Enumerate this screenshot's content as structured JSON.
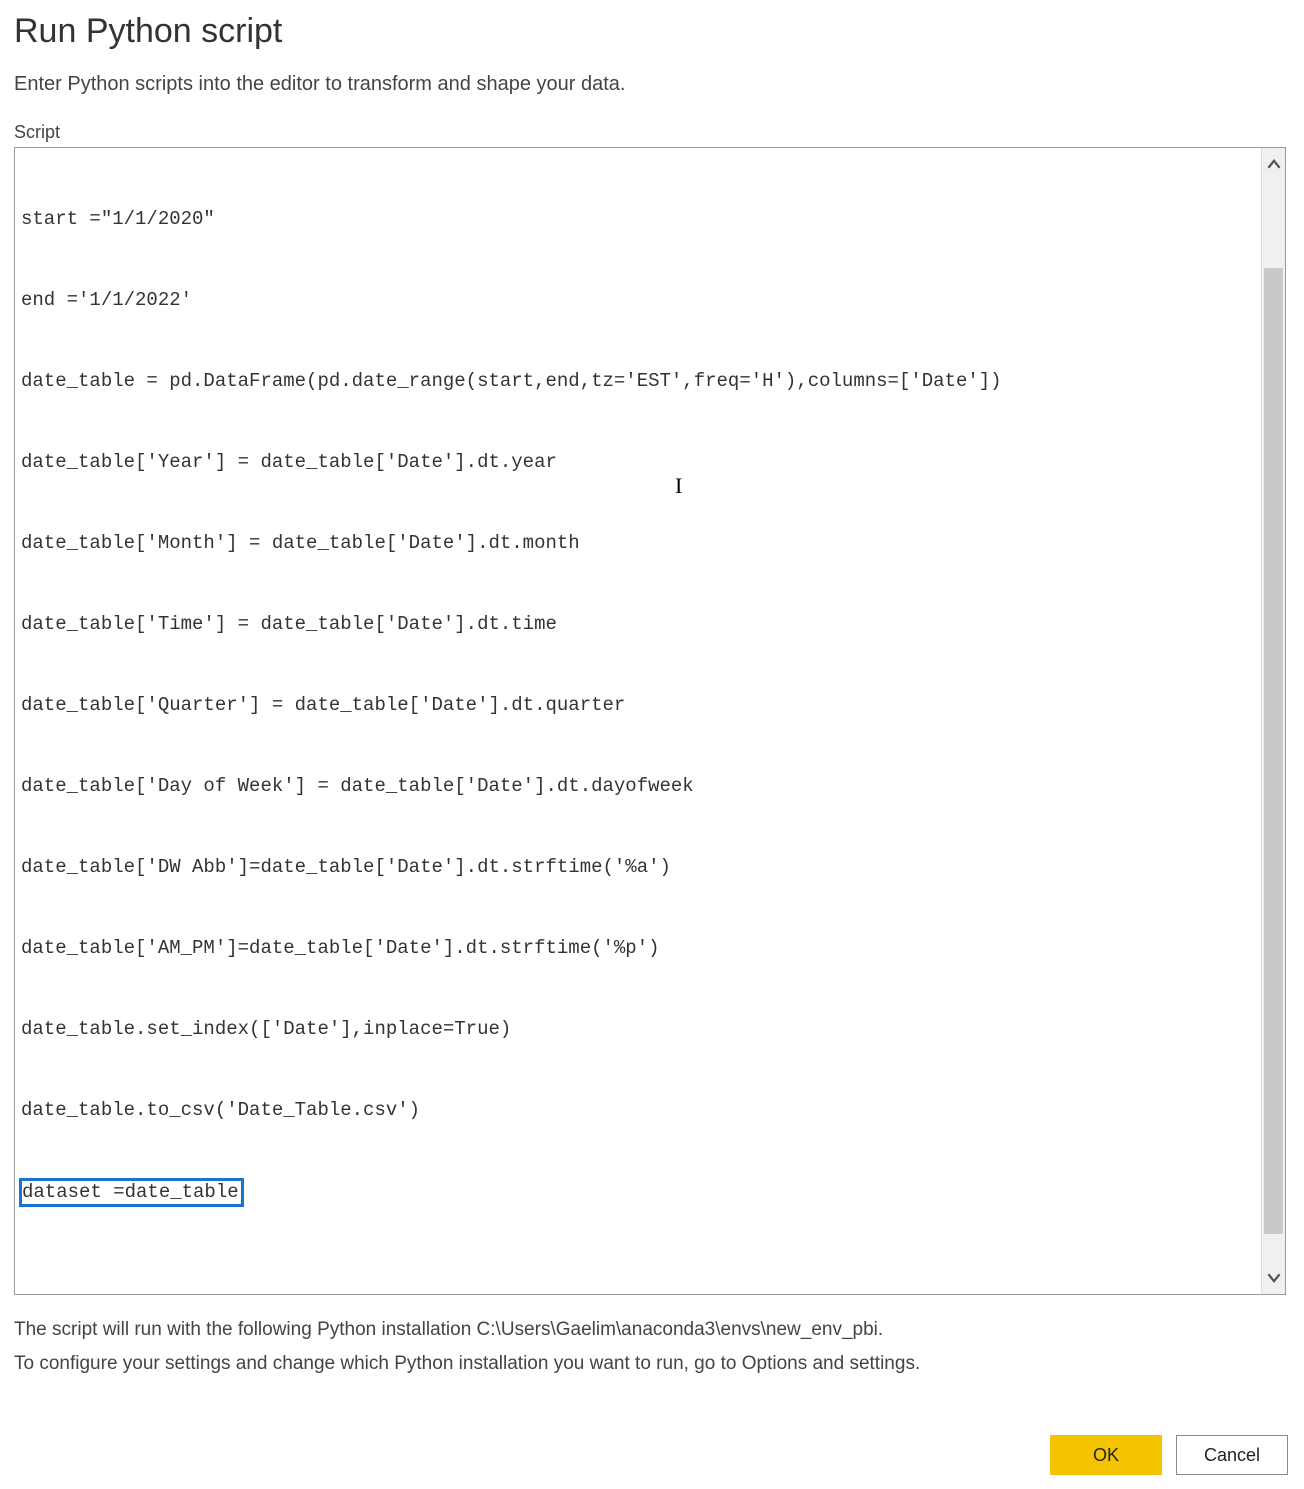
{
  "title": "Run Python script",
  "description": "Enter Python scripts into the editor to transform and shape your data.",
  "field_label": "Script",
  "code_lines": [
    "start =\"1/1/2020\"",
    "end ='1/1/2022'",
    "date_table = pd.DataFrame(pd.date_range(start,end,tz='EST',freq='H'),columns=['Date'])",
    "date_table['Year'] = date_table['Date'].dt.year",
    "date_table['Month'] = date_table['Date'].dt.month",
    "date_table['Time'] = date_table['Date'].dt.time",
    "date_table['Quarter'] = date_table['Date'].dt.quarter",
    "date_table['Day of Week'] = date_table['Date'].dt.dayofweek",
    "date_table['DW Abb']=date_table['Date'].dt.strftime('%a')",
    "date_table['AM_PM']=date_table['Date'].dt.strftime('%p')",
    "date_table.set_index(['Date'],inplace=True)",
    "date_table.to_csv('Date_Table.csv')"
  ],
  "highlighted_line": "dataset =date_table",
  "footnote_line1": "The script will run with the following Python installation C:\\Users\\Gaelim\\anaconda3\\envs\\new_env_pbi.",
  "footnote_line2": "To configure your settings and change which Python installation you want to run, go to Options and settings.",
  "buttons": {
    "ok": "OK",
    "cancel": "Cancel"
  }
}
